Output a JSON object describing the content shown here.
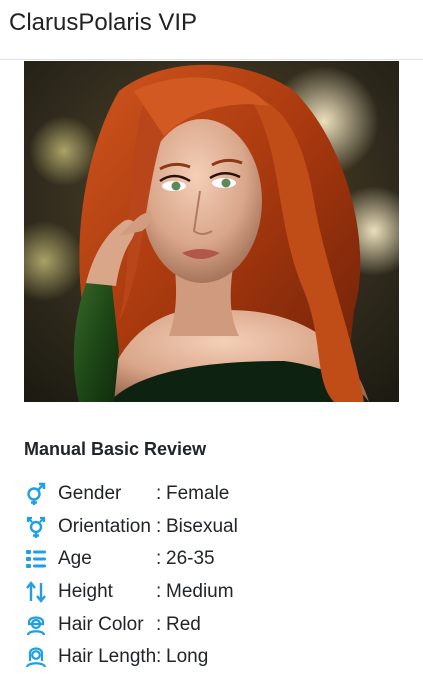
{
  "header": {
    "brand": "ClarusPolaris VIP"
  },
  "profile": {
    "photo_alt": "red-haired woman portrait",
    "section_title": "Manual Basic Review",
    "attributes": [
      {
        "icon": "gender-icon",
        "label": "Gender",
        "sep": ":",
        "value": "Female"
      },
      {
        "icon": "orientation-icon",
        "label": "Orientation",
        "sep": ":",
        "value": "Bisexual"
      },
      {
        "icon": "age-list-icon",
        "label": "Age",
        "sep": ":",
        "value": "26-35"
      },
      {
        "icon": "height-arrows-icon",
        "label": "Height",
        "sep": ":",
        "value": "Medium"
      },
      {
        "icon": "hair-color-icon",
        "label": "Hair Color",
        "sep": ":",
        "value": "Red"
      },
      {
        "icon": "hair-length-icon",
        "label": "Hair Length",
        "sep": ":",
        "value": "Long"
      }
    ]
  },
  "colors": {
    "icon_accent": "#1e9fe6",
    "text": "#212529",
    "border": "#e2e2e2"
  }
}
